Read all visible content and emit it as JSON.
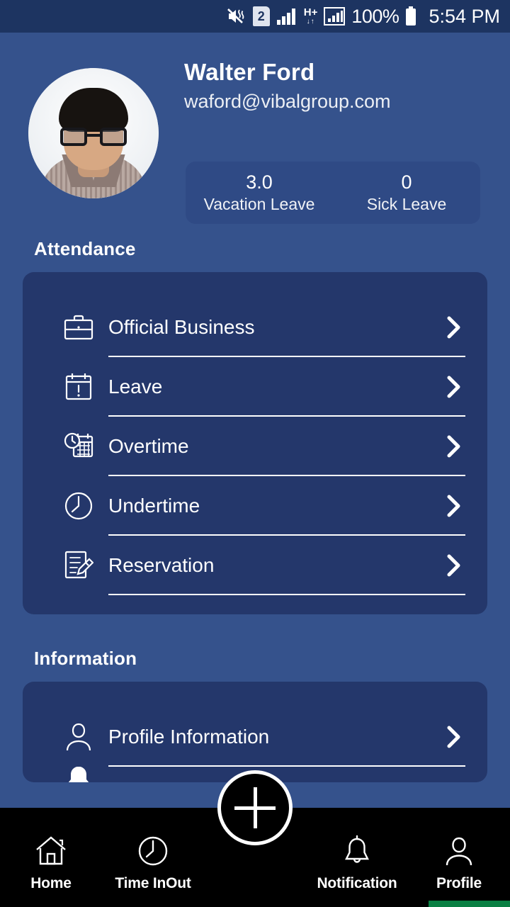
{
  "status_bar": {
    "mute_icon": "mute-vibrate-icon",
    "sim_badge": "2",
    "signal_icon": "signal-bars-icon",
    "network_type": "H+",
    "network_arrows": "↓↑",
    "signal2_icon": "signal-bars-boxed-icon",
    "battery_percent": "100%",
    "battery_icon": "battery-full-icon",
    "time": "5:54 PM"
  },
  "profile": {
    "avatar_alt": "user-avatar-photo",
    "name": "Walter Ford",
    "email": "waford@vibalgroup.com",
    "stats": [
      {
        "value": "3.0",
        "label": "Vacation Leave"
      },
      {
        "value": "0",
        "label": "Sick Leave"
      }
    ]
  },
  "sections": {
    "attendance": {
      "title": "Attendance",
      "items": [
        {
          "label": "Official Business",
          "icon": "briefcase-icon"
        },
        {
          "label": "Leave",
          "icon": "calendar-alert-icon"
        },
        {
          "label": "Overtime",
          "icon": "clock-calendar-icon"
        },
        {
          "label": "Undertime",
          "icon": "timer-icon"
        },
        {
          "label": "Reservation",
          "icon": "document-edit-icon"
        }
      ]
    },
    "information": {
      "title": "Information",
      "items": [
        {
          "label": "Profile Information",
          "icon": "person-icon"
        }
      ]
    }
  },
  "bottom_nav": {
    "items": [
      {
        "label": "Home",
        "icon": "home-icon"
      },
      {
        "label": "Time InOut",
        "icon": "timer-icon"
      },
      {
        "label": "Notification",
        "icon": "bell-icon"
      },
      {
        "label": "Profile",
        "icon": "person-icon"
      }
    ],
    "fab": {
      "icon": "plus-icon",
      "label": "+"
    }
  },
  "colors": {
    "page_background": "#35528c",
    "status_bar": "#1d3461",
    "card": "#24376b",
    "stats_panel": "#2f4a85",
    "nav_bar": "#000000",
    "home_indicator": "#0a8043",
    "text": "#ffffff"
  }
}
